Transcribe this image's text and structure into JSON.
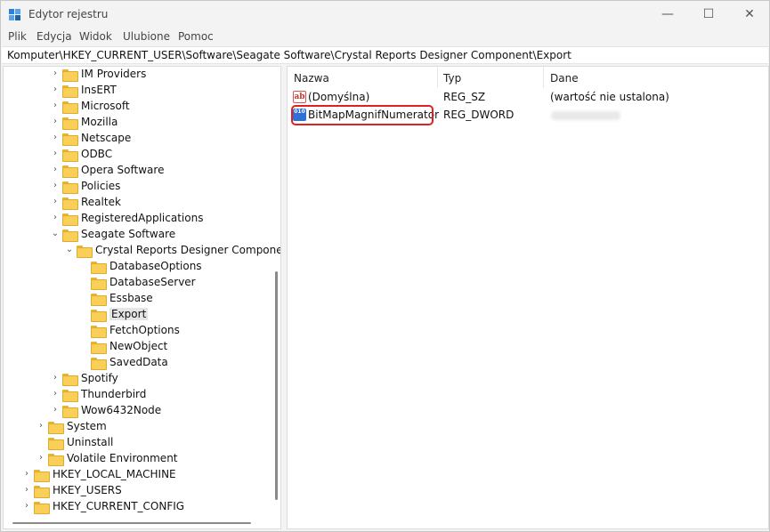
{
  "window": {
    "title": "Edytor rejestru",
    "controls": {
      "minimize": "—",
      "maximize": "☐",
      "close": "✕"
    }
  },
  "menu": [
    "Plik",
    "Edycja",
    "Widok",
    "Ulubione",
    "Pomoc"
  ],
  "address": "Komputer\\HKEY_CURRENT_USER\\Software\\Seagate Software\\Crystal Reports Designer Component\\Export",
  "tree": [
    {
      "label": "IM Providers",
      "expander": "›"
    },
    {
      "label": "InsERT",
      "expander": "›"
    },
    {
      "label": "Microsoft",
      "expander": "›"
    },
    {
      "label": "Mozilla",
      "expander": "›"
    },
    {
      "label": "Netscape",
      "expander": "›"
    },
    {
      "label": "ODBC",
      "expander": "›"
    },
    {
      "label": "Opera Software",
      "expander": "›"
    },
    {
      "label": "Policies",
      "expander": "›"
    },
    {
      "label": "Realtek",
      "expander": "›"
    },
    {
      "label": "RegisteredApplications",
      "expander": "›"
    },
    {
      "label": "Seagate Software",
      "expander": "⌄"
    },
    {
      "label": "Crystal Reports Designer Componen",
      "expander": "⌄"
    },
    {
      "label": "DatabaseOptions",
      "expander": ""
    },
    {
      "label": "DatabaseServer",
      "expander": ""
    },
    {
      "label": "Essbase",
      "expander": ""
    },
    {
      "label": "Export",
      "expander": "",
      "selected": true
    },
    {
      "label": "FetchOptions",
      "expander": ""
    },
    {
      "label": "NewObject",
      "expander": ""
    },
    {
      "label": "SavedData",
      "expander": ""
    },
    {
      "label": "Spotify",
      "expander": "›"
    },
    {
      "label": "Thunderbird",
      "expander": "›"
    },
    {
      "label": "Wow6432Node",
      "expander": "›"
    },
    {
      "label": "System",
      "expander": "›"
    },
    {
      "label": "Uninstall",
      "expander": ""
    },
    {
      "label": "Volatile Environment",
      "expander": "›"
    },
    {
      "label": "HKEY_LOCAL_MACHINE",
      "expander": "›"
    },
    {
      "label": "HKEY_USERS",
      "expander": "›"
    },
    {
      "label": "HKEY_CURRENT_CONFIG",
      "expander": "›"
    }
  ],
  "list": {
    "headers": {
      "name": "Nazwa",
      "type": "Typ",
      "data": "Dane"
    },
    "rows": [
      {
        "icon": "ab",
        "name": "(Domyślna)",
        "type": "REG_SZ",
        "data": "(wartość nie ustalona)"
      },
      {
        "icon": "010",
        "name": "BitMapMagnifNumerator",
        "type": "REG_DWORD",
        "data": ""
      }
    ]
  },
  "colors": {
    "highlight": "#e02020",
    "folder": "#f8cf58"
  }
}
